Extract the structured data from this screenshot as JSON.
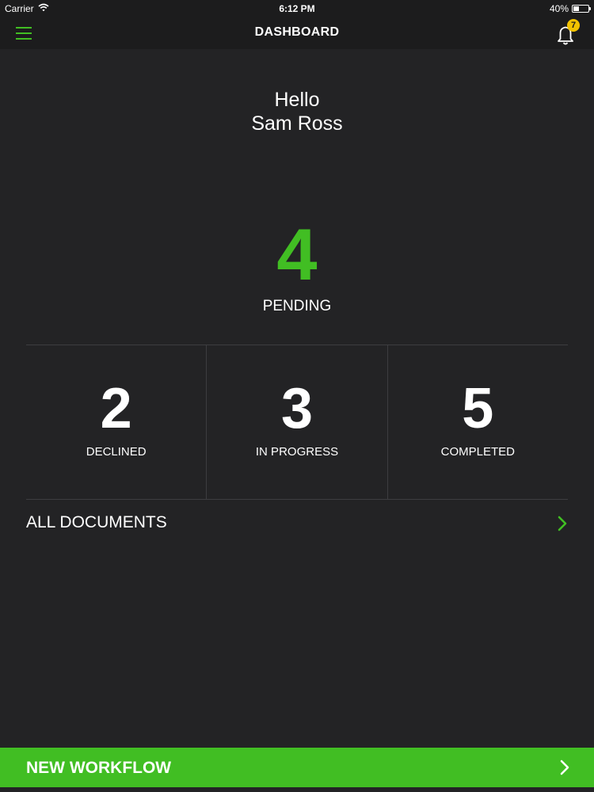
{
  "status_bar": {
    "carrier": "Carrier",
    "time": "6:12 PM",
    "battery_text": "40%",
    "battery_level": 0.4,
    "icons": [
      "wifi-icon",
      "battery-icon"
    ]
  },
  "nav": {
    "title": "DASHBOARD",
    "menu_icon": "hamburger-menu-icon",
    "bell_icon": "bell-icon",
    "notification_count": "7"
  },
  "greeting": {
    "hello": "Hello",
    "name": "Sam Ross"
  },
  "pending": {
    "count": "4",
    "label": "PENDING"
  },
  "stats": [
    {
      "count": "2",
      "label": "DECLINED"
    },
    {
      "count": "3",
      "label": "IN PROGRESS"
    },
    {
      "count": "5",
      "label": "COMPLETED"
    }
  ],
  "all_documents": {
    "label": "ALL DOCUMENTS",
    "icon": "chevron-right-icon"
  },
  "new_workflow": {
    "label": "NEW WORKFLOW",
    "icon": "chevron-right-icon"
  },
  "colors": {
    "accent": "#41be23",
    "background": "#232325",
    "bar": "#1c1c1d",
    "badge": "#f2c200"
  }
}
